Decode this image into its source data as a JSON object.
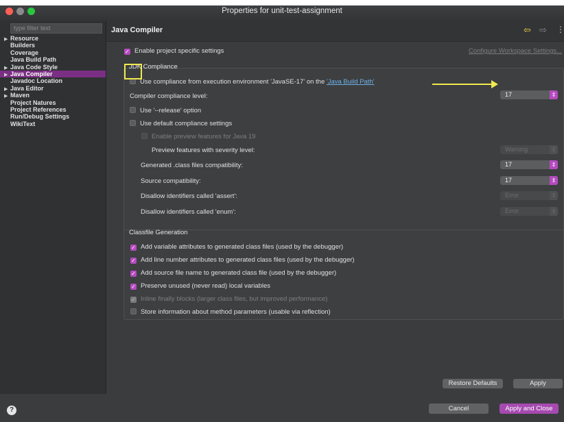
{
  "window": {
    "title": "Properties for unit-test-assignment"
  },
  "sidebar": {
    "filter_placeholder": "type filter text",
    "items": [
      {
        "label": "Resource",
        "expandable": true
      },
      {
        "label": "Builders"
      },
      {
        "label": "Coverage"
      },
      {
        "label": "Java Build Path"
      },
      {
        "label": "Java Code Style",
        "expandable": true
      },
      {
        "label": "Java Compiler",
        "expandable": true,
        "selected": true
      },
      {
        "label": "Javadoc Location"
      },
      {
        "label": "Java Editor",
        "expandable": true
      },
      {
        "label": "Maven",
        "expandable": true
      },
      {
        "label": "Project Natures"
      },
      {
        "label": "Project References"
      },
      {
        "label": "Run/Debug Settings"
      },
      {
        "label": "WikiText"
      }
    ]
  },
  "header": {
    "title": "Java Compiler",
    "back_icon": "arrow-left-icon",
    "forward_icon": "arrow-right-icon",
    "menu_icon": "kebab-menu-icon"
  },
  "project_specific": {
    "label": "Enable project specific settings",
    "checked": true
  },
  "configure_link": "Configure Workspace Settings...",
  "jdk": {
    "group_label": "JDK Compliance",
    "use_env": {
      "label_prefix": "Use compliance from execution environment 'JavaSE-17' on the ",
      "link": "'Java Build Path'",
      "checked": false
    },
    "compliance_level_label": "Compiler compliance level:",
    "compliance_level_value": "17",
    "release_option": {
      "label": "Use '--release' option",
      "checked": false
    },
    "default_compliance": {
      "label": "Use default compliance settings",
      "checked": false
    },
    "preview": {
      "label": "Enable preview features for Java 19",
      "checked": false
    },
    "preview_severity_label": "Preview features with severity level:",
    "preview_severity_value": "Warning",
    "class_compat_label": "Generated .class files compatibility:",
    "class_compat_value": "17",
    "source_compat_label": "Source compatibility:",
    "source_compat_value": "17",
    "assert_label": "Disallow identifiers called 'assert':",
    "assert_value": "Error",
    "enum_label": "Disallow identifiers called 'enum':",
    "enum_value": "Error"
  },
  "classfile": {
    "group_label": "Classfile Generation",
    "options": [
      {
        "label": "Add variable attributes to generated class files (used by the debugger)",
        "checked": true,
        "enabled": true
      },
      {
        "label": "Add line number attributes to generated class files (used by the debugger)",
        "checked": true,
        "enabled": true
      },
      {
        "label": "Add source file name to generated class file (used by the debugger)",
        "checked": true,
        "enabled": true
      },
      {
        "label": "Preserve unused (never read) local variables",
        "checked": true,
        "enabled": true
      },
      {
        "label": "Inline finally blocks (larger class files, but improved performance)",
        "checked": true,
        "enabled": false
      },
      {
        "label": "Store information about method parameters (usable via reflection)",
        "checked": false,
        "enabled": true
      }
    ]
  },
  "buttons": {
    "restore_defaults": "Restore Defaults",
    "apply": "Apply",
    "cancel": "Cancel",
    "apply_and_close": "Apply and Close",
    "help_icon": "help-icon"
  },
  "colors": {
    "accent": "#b54bc0",
    "annotation": "#f2e94e",
    "selection": "#7b2f84"
  }
}
